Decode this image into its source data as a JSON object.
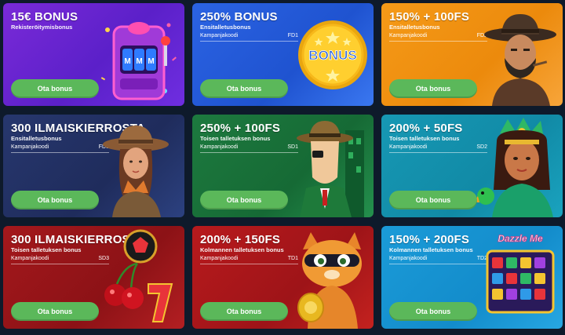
{
  "cards": [
    {
      "title": "15€ BONUS",
      "subtitle": "Rekisteröitymisbonus",
      "code_label": "",
      "code": "",
      "button": "Ota bonus",
      "art": "slot-machine-icon"
    },
    {
      "title": "250% BONUS",
      "subtitle": "Ensitalletusbonus",
      "code_label": "Kampanjakoodi",
      "code": "FD1",
      "button": "Ota bonus",
      "art": "bonus-coin-icon",
      "coin_text": "BONUS"
    },
    {
      "title": "150% + 100FS",
      "subtitle": "Ensitalletusbonus",
      "code_label": "Kampanjakoodi",
      "code": "FD2",
      "button": "Ota bonus",
      "art": "cowboy-icon"
    },
    {
      "title": "300 ILMAISKIERROSTA",
      "subtitle": "Ensitalletusbonus",
      "code_label": "Kampanjakoodi",
      "code": "FD3",
      "button": "Ota bonus",
      "art": "explorer-icon"
    },
    {
      "title": "250% + 100FS",
      "subtitle": "Toisen talletuksen bonus",
      "code_label": "Kampanjakoodi",
      "code": "SD1",
      "button": "Ota bonus",
      "art": "detective-icon"
    },
    {
      "title": "200% + 50FS",
      "subtitle": "Toisen talletuksen bonus",
      "code_label": "Kampanjakoodi",
      "code": "SD2",
      "button": "Ota bonus",
      "art": "aztec-girl-icon"
    },
    {
      "title": "300 ILMAISKIERROSTA",
      "subtitle": "Toisen talletuksen bonus",
      "code_label": "Kampanjakoodi",
      "code": "SD3",
      "button": "Ota bonus",
      "art": "cherries-seven-icon"
    },
    {
      "title": "200% + 150FS",
      "subtitle": "Kolmannen talletuksen bonus",
      "code_label": "Kampanjakoodi",
      "code": "TD1",
      "button": "Ota bonus",
      "art": "bandit-cat-icon"
    },
    {
      "title": "150% + 200FS",
      "subtitle": "Kolmannen talletuksen bonus",
      "code_label": "Kampanjakoodi",
      "code": "TD2",
      "button": "Ota bonus",
      "art": "dazzle-me-slot-icon",
      "game_logo": "Dazzle Me"
    }
  ],
  "colors": {
    "button": "#5bb85a",
    "page_background": "#0e1a2b"
  }
}
